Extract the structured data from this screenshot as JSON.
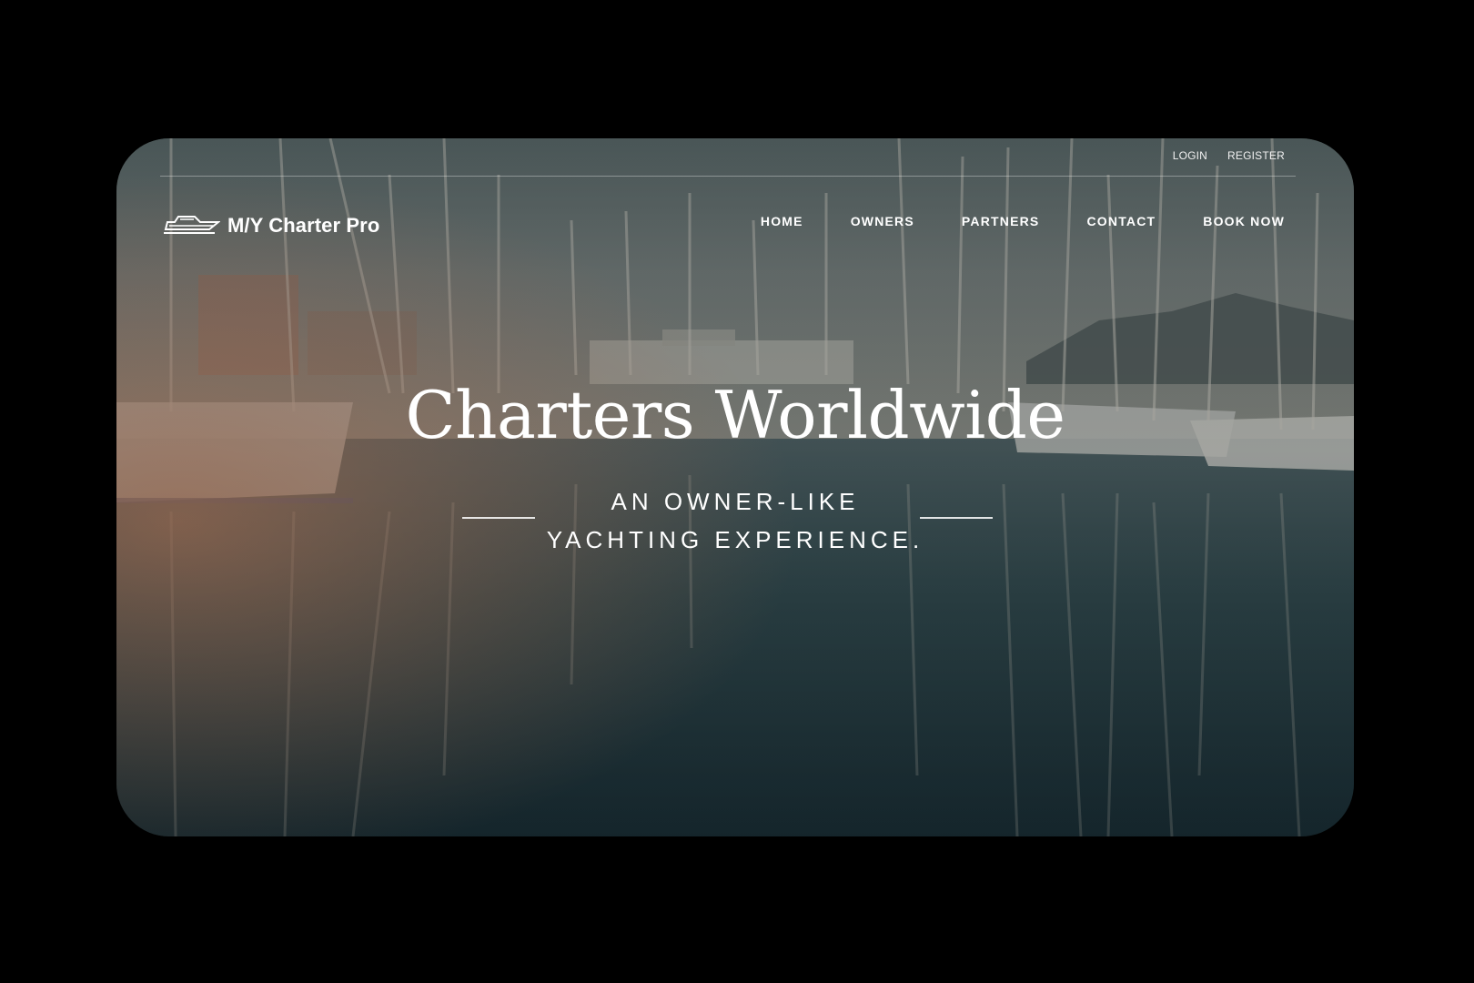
{
  "util": {
    "login": "LOGIN",
    "register": "REGISTER"
  },
  "brand": {
    "name": "M/Y Charter Pro"
  },
  "nav": {
    "items": [
      {
        "label": "HOME"
      },
      {
        "label": "OWNERS"
      },
      {
        "label": "PARTNERS"
      },
      {
        "label": "CONTACT"
      },
      {
        "label": "BOOK NOW"
      }
    ]
  },
  "hero": {
    "title": "Charters Worldwide",
    "subtitle_line1": "AN OWNER-LIKE",
    "subtitle_line2": "YACHTING EXPERIENCE."
  },
  "colors": {
    "text": "#ffffff",
    "page_background": "#000000"
  }
}
